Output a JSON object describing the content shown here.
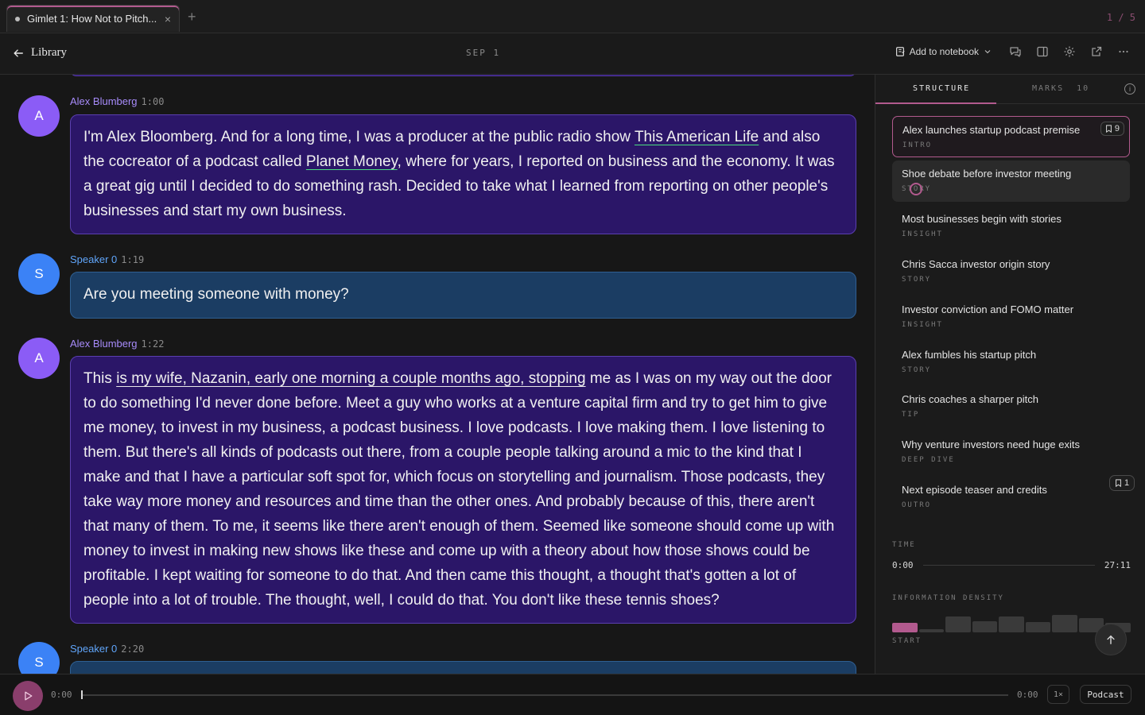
{
  "tab": {
    "title": "Gimlet 1: How Not to Pitch...",
    "add": "+",
    "close": "×",
    "counter": "1 / 5"
  },
  "header": {
    "back_label": "Library",
    "date": "SEP 1",
    "notebook_label": "Add to notebook",
    "icons": [
      "notebook-icon",
      "chevron-down-icon",
      "comments-icon",
      "split-view-icon",
      "gear-icon",
      "external-link-icon",
      "more-icon"
    ]
  },
  "messages": [
    {
      "initial": "A",
      "speaker": "Alex Blumberg",
      "time": "1:00",
      "segments": [
        "I'm Alex Bloomberg. And for a long time, I was a producer at the public radio show ",
        "This American Life",
        " and also the cocreator of a podcast called ",
        "Planet Money",
        ", where for years, I reported on business and the economy. It was a great gig until I decided to do something rash. Decided to take what I learned from reporting on other people's businesses and start my own business."
      ]
    },
    {
      "initial": "S",
      "speaker": "Speaker 0",
      "time": "1:19",
      "text": "Are you meeting someone with money?"
    },
    {
      "initial": "A",
      "speaker": "Alex Blumberg",
      "time": "1:22",
      "segments": [
        "This ",
        "is my wife, Nazanin, early one morning a couple months ago, stopping",
        " me as I was on my way out the door to do something I'd never done before. Meet a guy who works at a venture capital firm and try to get him to give me money, to invest in my business, a podcast business. I love podcasts. I love making them. I love listening to them. But there's all kinds of podcasts out there, from a couple people talking around a mic to the kind that I make and that I have a particular soft spot for, which focus on storytelling and journalism. Those podcasts, they take way more money and resources and time than the other ones. And probably because of this, there aren't that many of them. To me, it seems like there aren't enough of them. Seemed like someone should come up with money to invest in making new shows like these and come up with a theory about how those shows could be profitable. I kept waiting for someone to do that. And then came this thought, a thought that's gotten a lot of people into a lot of trouble. The thought, well, I could do that. You don't like these tennis shoes?"
      ]
    },
    {
      "initial": "S",
      "speaker": "Speaker 0",
      "time": "2:20"
    }
  ],
  "panel": {
    "tab_structure": "STRUCTURE",
    "tab_marks": "MARKS",
    "marks_count": "10",
    "info": "i",
    "sections": [
      {
        "title": "Alex launches startup podcast premise",
        "tag": "INTRO",
        "marks": "9"
      },
      {
        "title": "Shoe debate before investor meeting",
        "tag": "STORY"
      },
      {
        "title": "Most businesses begin with stories",
        "tag": "INSIGHT"
      },
      {
        "title": "Chris Sacca investor origin story",
        "tag": "STORY"
      },
      {
        "title": "Investor conviction and FOMO matter",
        "tag": "INSIGHT"
      },
      {
        "title": "Alex fumbles his startup pitch",
        "tag": "STORY"
      },
      {
        "title": "Chris coaches a sharper pitch",
        "tag": "TIP"
      },
      {
        "title": "Why venture investors need huge exits",
        "tag": "DEEP DIVE"
      },
      {
        "title": "Next episode teaser and credits",
        "tag": "OUTRO",
        "marks": "1"
      }
    ],
    "time_label": "TIME",
    "time_start": "0:00",
    "time_end": "27:11",
    "density_label": "INFORMATION DENSITY",
    "density_start": "START",
    "density_levels": [
      0.45,
      0.15,
      0.75,
      0.55,
      0.75,
      0.5,
      0.85,
      0.7,
      0.45
    ],
    "accent": "#b25a8e"
  },
  "player": {
    "current": "0:00",
    "end": "0:00",
    "speed": "1×",
    "mode": "Podcast",
    "progress": 0
  }
}
